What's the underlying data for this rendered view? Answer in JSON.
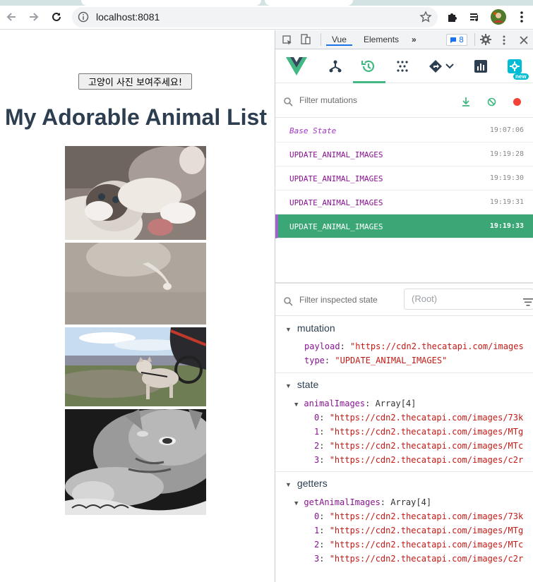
{
  "browser": {
    "url": "localhost:8081",
    "icons": [
      "back-arrow-icon",
      "forward-arrow-icon",
      "reload-icon",
      "info-icon",
      "star-icon",
      "puzzle-icon",
      "media-queue-icon",
      "profile-avatar",
      "more-vertical-icon"
    ]
  },
  "page": {
    "button_label": "고양이 사진 보여주세요!",
    "title": "My Adorable Animal List"
  },
  "devtools": {
    "tabs": {
      "vue": "Vue",
      "elements": "Elements",
      "more": "»"
    },
    "issues_count": "8",
    "new_badge": "new",
    "filter_mutations_placeholder": "Filter mutations",
    "mutations": [
      {
        "name": "Base State",
        "time": "19:07:06"
      },
      {
        "name": "UPDATE_ANIMAL_IMAGES",
        "time": "19:19:28"
      },
      {
        "name": "UPDATE_ANIMAL_IMAGES",
        "time": "19:19:30"
      },
      {
        "name": "UPDATE_ANIMAL_IMAGES",
        "time": "19:19:31"
      },
      {
        "name": "UPDATE_ANIMAL_IMAGES",
        "time": "19:19:33"
      }
    ],
    "filter_state_placeholder": "Filter inspected state",
    "root_placeholder": "(Root)",
    "mutation": {
      "heading": "mutation",
      "payload_key": "payload",
      "payload_value": "\"https://cdn2.thecatapi.com/images",
      "type_key": "type",
      "type_value": "\"UPDATE_ANIMAL_IMAGES\""
    },
    "state": {
      "heading": "state",
      "key": "animalImages",
      "type": "Array[4]",
      "items": [
        "\"https://cdn2.thecatapi.com/images/73k",
        "\"https://cdn2.thecatapi.com/images/MTg",
        "\"https://cdn2.thecatapi.com/images/MTc",
        "\"https://cdn2.thecatapi.com/images/c2r"
      ]
    },
    "getters": {
      "heading": "getters",
      "key": "getAnimalImages",
      "type": "Array[4]",
      "items": [
        "\"https://cdn2.thecatapi.com/images/73k",
        "\"https://cdn2.thecatapi.com/images/MTg",
        "\"https://cdn2.thecatapi.com/images/MTc",
        "\"https://cdn2.thecatapi.com/images/c2r"
      ]
    },
    "colors": {
      "vue_green": "#42b883",
      "selected_row": "#3ba776",
      "key_purple": "#881391",
      "string_red": "#c41a16"
    }
  }
}
